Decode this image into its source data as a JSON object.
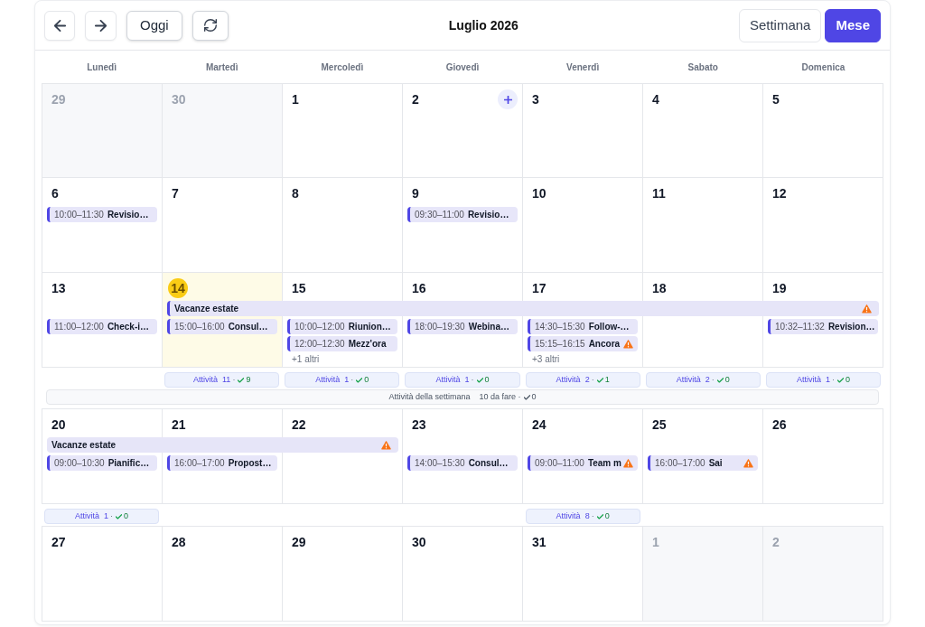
{
  "toolbar": {
    "buttons": [
      {
        "kind": "prev"
      },
      {
        "kind": "next"
      },
      {
        "kind": "today",
        "label": "Oggi"
      },
      {
        "kind": "refresh"
      }
    ]
  },
  "title": "Luglio 2026",
  "views": [
    {
      "label": "Settimana",
      "selected": false
    },
    {
      "label": "Mese",
      "selected": true
    }
  ],
  "weekdays": [
    "Lunedì",
    "Martedì",
    "Mercoledì",
    "Giovedì",
    "Venerdì",
    "Sabato",
    "Domenica"
  ],
  "weeks": [
    {
      "days": [
        {
          "number": "29",
          "in_month": false,
          "today": false,
          "hovered": false
        },
        {
          "number": "30",
          "in_month": false,
          "today": false,
          "hovered": false
        },
        {
          "number": "1",
          "in_month": true,
          "today": false,
          "hovered": false
        },
        {
          "number": "2",
          "in_month": true,
          "today": false,
          "hovered": true
        },
        {
          "number": "3",
          "in_month": true,
          "today": false,
          "hovered": false
        },
        {
          "number": "4",
          "in_month": true,
          "today": false,
          "hovered": false
        },
        {
          "number": "5",
          "in_month": true,
          "today": false,
          "hovered": false
        }
      ]
    },
    {
      "days": [
        {
          "number": "6",
          "in_month": true,
          "today": false,
          "hovered": false,
          "events": [
            {
              "time": "10:00–11:30",
              "title": "Revisio…",
              "warning": false
            }
          ]
        },
        {
          "number": "7",
          "in_month": true,
          "today": false,
          "hovered": false
        },
        {
          "number": "8",
          "in_month": true,
          "today": false,
          "hovered": false
        },
        {
          "number": "9",
          "in_month": true,
          "today": false,
          "hovered": false,
          "events": [
            {
              "time": "09:30–11:00",
              "title": "Revisio…",
              "warning": false
            }
          ]
        },
        {
          "number": "10",
          "in_month": true,
          "today": false,
          "hovered": false
        },
        {
          "number": "11",
          "in_month": true,
          "today": false,
          "hovered": false
        },
        {
          "number": "12",
          "in_month": true,
          "today": false,
          "hovered": false
        }
      ]
    },
    {
      "banner": {
        "title": "Vacanze estate",
        "warning": true,
        "continued": false
      },
      "days": [
        {
          "number": "13",
          "in_month": true,
          "today": false,
          "hovered": false,
          "in_banner": false,
          "events": [
            {
              "time": "11:00–12:00",
              "title": "Check-i…",
              "warning": false
            }
          ]
        },
        {
          "number": "14",
          "in_month": true,
          "today": true,
          "hovered": false,
          "in_banner": true,
          "events": [
            {
              "time": "15:00–16:00",
              "title": "Consul…",
              "warning": false
            }
          ],
          "activity": {
            "label": "Attività",
            "count": "11",
            "separator": "·",
            "done": "9"
          }
        },
        {
          "number": "15",
          "in_month": true,
          "today": false,
          "hovered": false,
          "in_banner": true,
          "events": [
            {
              "time": "10:00–12:00",
              "title": "Riunion…",
              "warning": false
            },
            {
              "time": "12:00–12:30",
              "title": "Mezz'ora",
              "warning": false
            }
          ],
          "more": "+1 altri",
          "activity": {
            "label": "Attività",
            "count": "1",
            "separator": "·",
            "done": "0"
          }
        },
        {
          "number": "16",
          "in_month": true,
          "today": false,
          "hovered": false,
          "in_banner": true,
          "events": [
            {
              "time": "18:00–19:30",
              "title": "Webina…",
              "warning": false
            }
          ],
          "activity": {
            "label": "Attività",
            "count": "1",
            "separator": "·",
            "done": "0"
          }
        },
        {
          "number": "17",
          "in_month": true,
          "today": false,
          "hovered": false,
          "in_banner": true,
          "events": [
            {
              "time": "14:30–15:30",
              "title": "Follow-…",
              "warning": false
            },
            {
              "time": "15:15–16:15",
              "title": "Ancora",
              "warning": true
            }
          ],
          "more": "+3 altri",
          "activity": {
            "label": "Attività",
            "count": "2",
            "separator": "·",
            "done": "1"
          }
        },
        {
          "number": "18",
          "in_month": true,
          "today": false,
          "hovered": false,
          "in_banner": true,
          "activity": {
            "label": "Attività",
            "count": "2",
            "separator": "·",
            "done": "0"
          }
        },
        {
          "number": "19",
          "in_month": true,
          "today": false,
          "hovered": false,
          "in_banner": true,
          "events": [
            {
              "time": "10:32–11:32",
              "title": "Revision…",
              "warning": false
            }
          ],
          "activity": {
            "label": "Attività",
            "count": "1",
            "separator": "·",
            "done": "0"
          }
        }
      ],
      "summary": {
        "label": "Attività della settimana",
        "todo": "10 da fare",
        "separator": "·",
        "done": "0"
      }
    },
    {
      "banner": {
        "title": "Vacanze estate",
        "warning": true,
        "continued": true
      },
      "days": [
        {
          "number": "20",
          "in_month": true,
          "today": false,
          "hovered": false,
          "in_banner": true,
          "events": [
            {
              "time": "09:00–10:30",
              "title": "Pianific…",
              "warning": false
            }
          ],
          "activity": {
            "label": "Attività",
            "count": "1",
            "separator": "·",
            "done": "0"
          }
        },
        {
          "number": "21",
          "in_month": true,
          "today": false,
          "hovered": false,
          "in_banner": true,
          "events": [
            {
              "time": "16:00–17:00",
              "title": "Propost…",
              "warning": false
            }
          ]
        },
        {
          "number": "22",
          "in_month": true,
          "today": false,
          "hovered": false,
          "in_banner": true
        },
        {
          "number": "23",
          "in_month": true,
          "today": false,
          "hovered": false,
          "in_banner": false,
          "events": [
            {
              "time": "14:00–15:30",
              "title": "Consul…",
              "warning": false
            }
          ]
        },
        {
          "number": "24",
          "in_month": true,
          "today": false,
          "hovered": false,
          "in_banner": false,
          "events": [
            {
              "time": "09:00–11:00",
              "title": "Team m",
              "warning": true
            }
          ],
          "activity": {
            "label": "Attività",
            "count": "8",
            "separator": "·",
            "done": "0"
          }
        },
        {
          "number": "25",
          "in_month": true,
          "today": false,
          "hovered": false,
          "in_banner": false,
          "events": [
            {
              "time": "16:00–17:00",
              "title": "Sai",
              "warning": true
            }
          ]
        },
        {
          "number": "26",
          "in_month": true,
          "today": false,
          "hovered": false,
          "in_banner": false
        }
      ]
    },
    {
      "days": [
        {
          "number": "27",
          "in_month": true,
          "today": false,
          "hovered": false
        },
        {
          "number": "28",
          "in_month": true,
          "today": false,
          "hovered": false
        },
        {
          "number": "29",
          "in_month": true,
          "today": false,
          "hovered": false
        },
        {
          "number": "30",
          "in_month": true,
          "today": false,
          "hovered": false
        },
        {
          "number": "31",
          "in_month": true,
          "today": false,
          "hovered": false
        },
        {
          "number": "1",
          "in_month": false,
          "today": false,
          "hovered": false
        },
        {
          "number": "2",
          "in_month": false,
          "today": false,
          "hovered": false
        }
      ]
    }
  ]
}
